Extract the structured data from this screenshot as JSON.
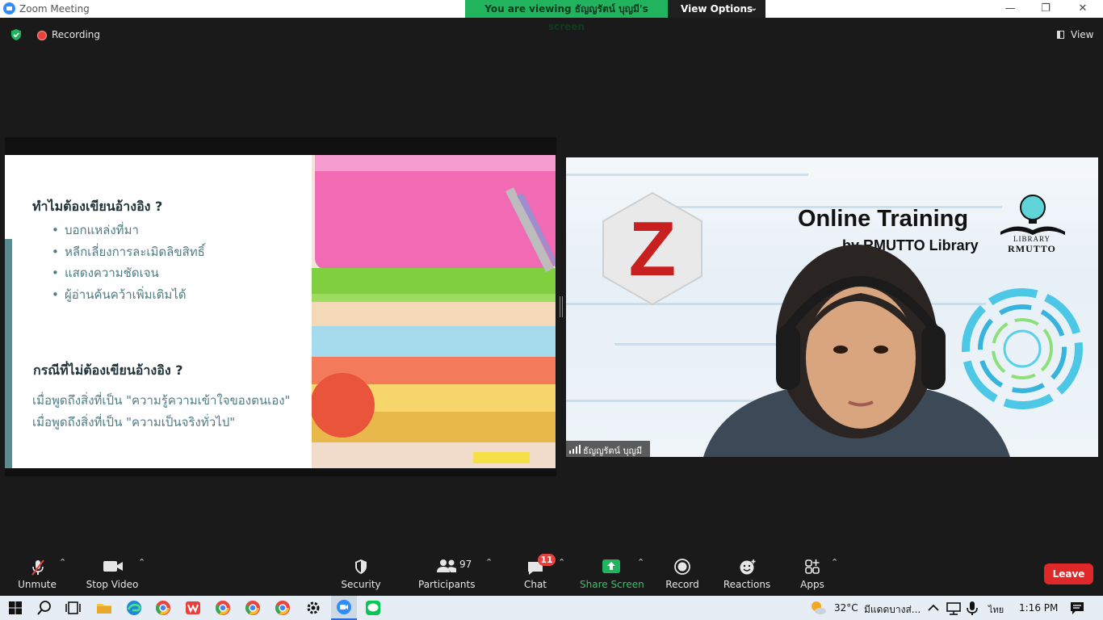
{
  "window": {
    "title": "Zoom Meeting",
    "minimize": "—",
    "restore": "❐",
    "close": "✕"
  },
  "banner": {
    "viewing_text": "You are viewing ธัญญรัตน์ บุญมี's screen",
    "view_options": "View Options",
    "chevron": "⌄"
  },
  "top": {
    "recording": "Recording",
    "view": "View"
  },
  "slide": {
    "heading1": "ทำไมต้องเขียนอ้างอิง ?",
    "bullets": [
      "บอกแหล่งที่มา",
      "หลีกเลี่ยงการละเมิดลิขสิทธิ์",
      "แสดงความชัดเจน",
      "ผู้อ่านค้นคว้าเพิ่มเติมได้"
    ],
    "heading2": "กรณีที่ไม่ต้องเขียนอ้างอิง ?",
    "line1": "เมื่อพูดถึงสิ่งที่เป็น \"ความรู้ความเข้าใจของตนเอง\"",
    "line2": "เมื่อพูดถึงสิ่งที่เป็น \"ความเป็นจริงทั่วไป\""
  },
  "video": {
    "title": "Online Training",
    "subtitle": "by RMUTTO Library",
    "logo_top": "LIBRARY",
    "logo_bottom": "RMUTTO",
    "participant_name": "ธัญญรัตน์ บุญมี",
    "zotero_letter": "Z"
  },
  "toolbar": {
    "unmute": "Unmute",
    "stop_video": "Stop Video",
    "security": "Security",
    "participants": "Participants",
    "participants_count": "97",
    "chat": "Chat",
    "chat_badge": "11",
    "share_screen": "Share Screen",
    "record": "Record",
    "reactions": "Reactions",
    "apps": "Apps",
    "leave": "Leave",
    "caret": "⌃"
  },
  "taskbar": {
    "temperature": "32°C",
    "weather": "มีแดดบางส่...",
    "language": "ไทย",
    "time": "1:16 PM"
  },
  "colors": {
    "share_green": "#22b35e",
    "leave_red": "#e02828",
    "slide_text": "#4f7c83"
  }
}
